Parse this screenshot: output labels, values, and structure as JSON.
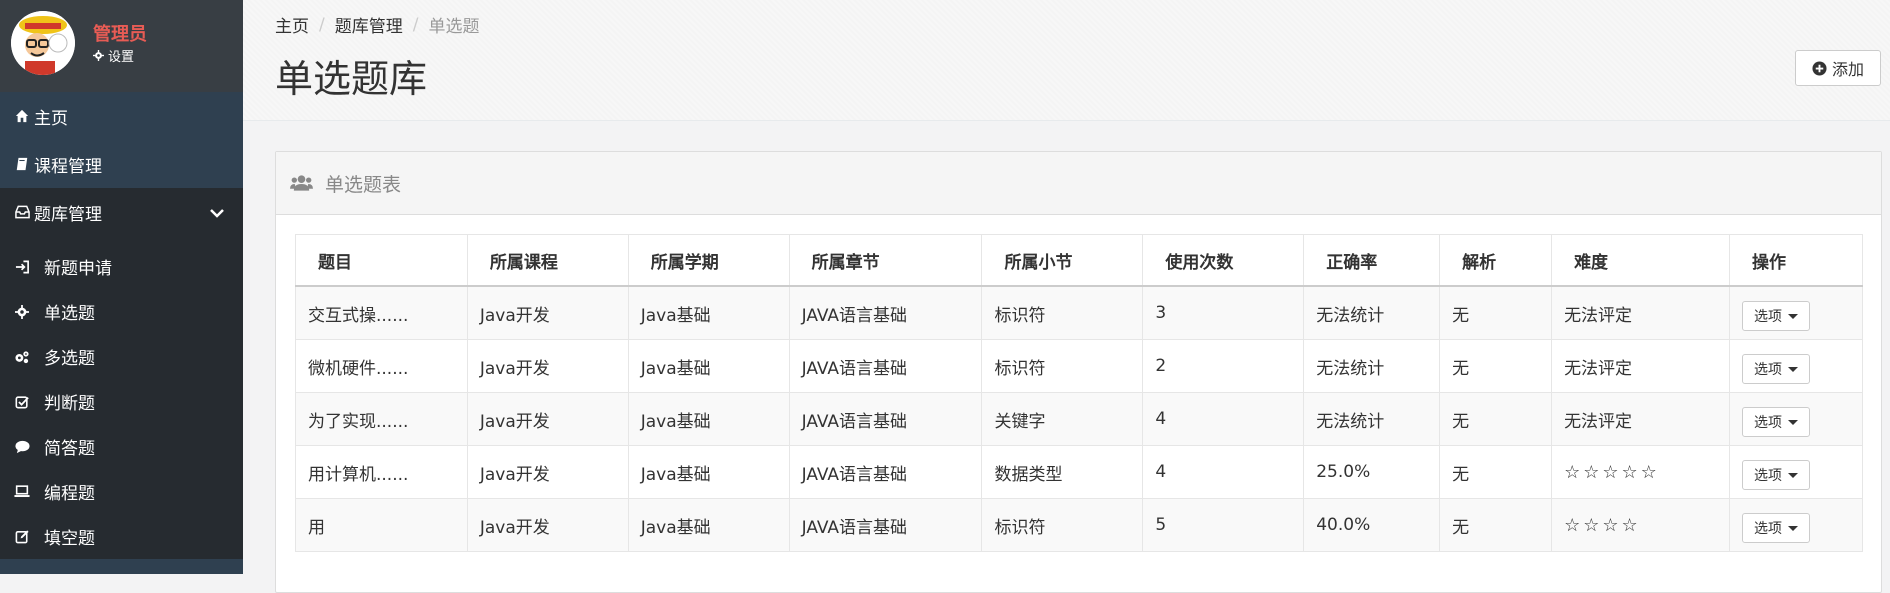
{
  "user": {
    "name": "管理员",
    "settings_label": "设置"
  },
  "nav": {
    "home": "主页",
    "course": "课程管理",
    "bank": "题库管理",
    "sub": [
      "新题申请",
      "单选题",
      "多选题",
      "判断题",
      "简答题",
      "编程题",
      "填空题"
    ]
  },
  "breadcrumb": [
    "主页",
    "题库管理",
    "单选题"
  ],
  "page": {
    "title": "单选题库",
    "add_label": "添加"
  },
  "panel": {
    "title": "单选题表"
  },
  "table": {
    "headers": [
      "题目",
      "所属课程",
      "所属学期",
      "所属章节",
      "所属小节",
      "使用次数",
      "正确率",
      "解析",
      "难度",
      "操作"
    ],
    "rows": [
      [
        "交互式操......",
        "Java开发",
        "Java基础",
        "JAVA语言基础",
        "标识符",
        "3",
        "无法统计",
        "无",
        "无法评定",
        "选项"
      ],
      [
        "微机硬件......",
        "Java开发",
        "Java基础",
        "JAVA语言基础",
        "标识符",
        "2",
        "无法统计",
        "无",
        "无法评定",
        "选项"
      ],
      [
        "为了实现......",
        "Java开发",
        "Java基础",
        "JAVA语言基础",
        "关键字",
        "4",
        "无法统计",
        "无",
        "无法评定",
        "选项"
      ],
      [
        "用计算机......",
        "Java开发",
        "Java基础",
        "JAVA语言基础",
        "数据类型",
        "4",
        "25.0%",
        "无",
        "☆☆☆☆☆",
        "选项"
      ],
      [
        "用",
        "Java开发",
        "Java基础",
        "JAVA语言基础",
        "标识符",
        "5",
        "40.0%",
        "无",
        "☆☆☆☆",
        "选项"
      ]
    ]
  },
  "colors": {
    "sidebar": "#2f4050",
    "sidebar_active": "#262b30",
    "user_name": "#e85c55"
  },
  "icons": [
    "home-icon",
    "book-icon",
    "inbox-icon",
    "chevron-down-icon",
    "sign-in-icon",
    "gear-icon",
    "gears-icon",
    "check-square-icon",
    "comment-icon",
    "laptop-icon",
    "edit-icon",
    "plus-circle-icon",
    "users-icon",
    "caret-down-icon"
  ]
}
